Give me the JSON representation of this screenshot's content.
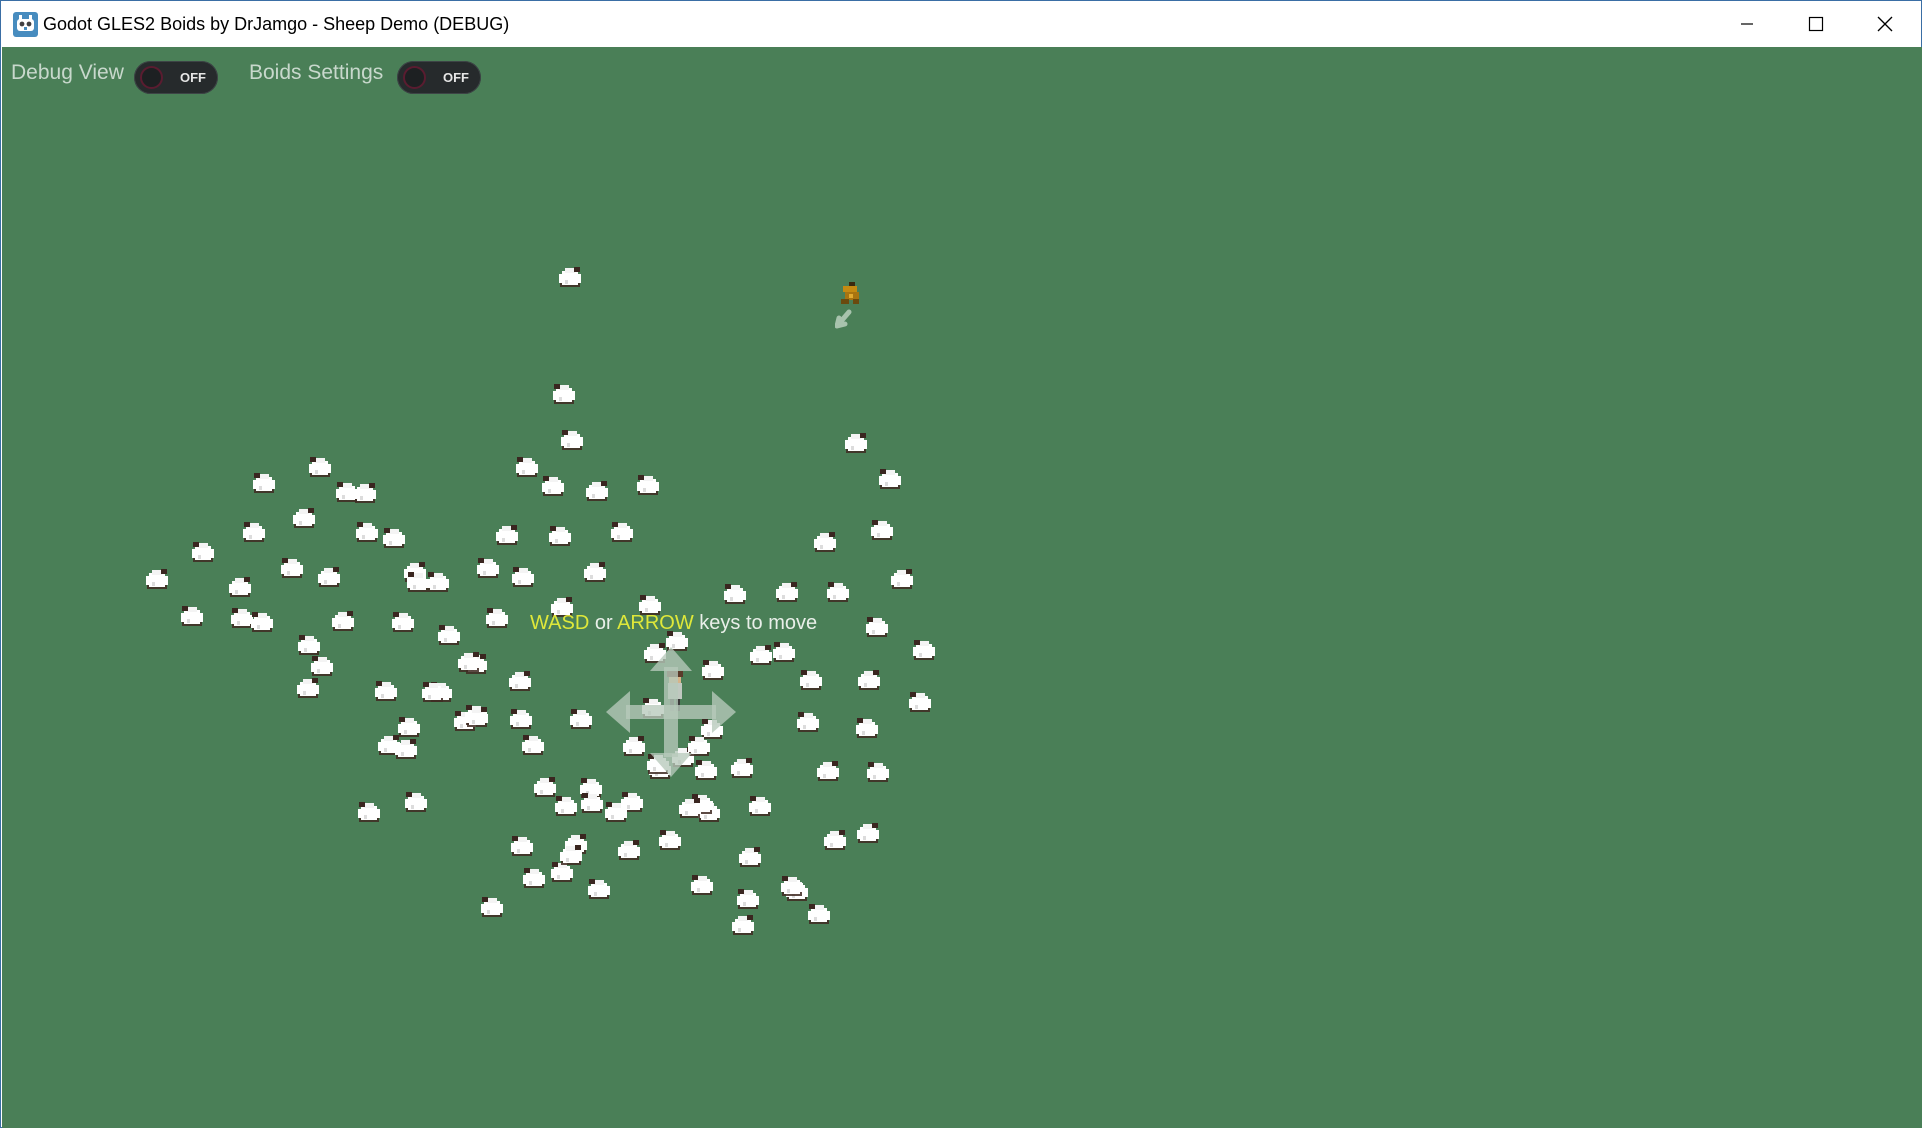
{
  "window": {
    "title": "Godot GLES2 Boids by DrJamgo - Sheep Demo (DEBUG)",
    "icon": "godot-icon",
    "controls": [
      "minimize-icon",
      "maximize-icon",
      "close-icon"
    ]
  },
  "hud": {
    "debug_view": {
      "label": "Debug View",
      "state": "OFF"
    },
    "boids_settings": {
      "label": "Boids Settings",
      "state": "OFF"
    }
  },
  "hint": {
    "key1": "WASD",
    "or": " or ",
    "key2": "ARROW",
    "rest": " keys to move"
  },
  "scene": {
    "background_color": "#4a7f57",
    "key_highlight_color": "#dfe83a",
    "sheep_count": 118,
    "entities": [
      "player-shepherd",
      "sheepdog",
      "sheep-flock",
      "move-arrows-icon"
    ]
  }
}
